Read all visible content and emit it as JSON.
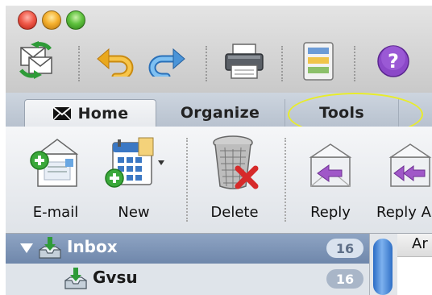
{
  "window": {
    "buttons": [
      "close",
      "minimize",
      "zoom"
    ]
  },
  "toolbar": {
    "icons": [
      "send-receive-icon",
      "undo-icon",
      "redo-icon",
      "print-icon",
      "document-gallery-icon",
      "help-icon"
    ]
  },
  "tabs": [
    {
      "label": "Home",
      "selected": true
    },
    {
      "label": "Organize",
      "selected": false
    },
    {
      "label": "Tools",
      "selected": false,
      "highlighted": true
    }
  ],
  "ribbon": {
    "email": "E-mail",
    "new": "New",
    "delete": "Delete",
    "reply": "Reply",
    "reply_all": "Reply A"
  },
  "folders": [
    {
      "name": "Inbox",
      "count": "16",
      "expanded": true,
      "selected": true
    },
    {
      "name": "Gvsu",
      "count": "16",
      "expanded": false,
      "selected": false
    }
  ],
  "message_list": {
    "header_partial": "Ar"
  },
  "colors": {
    "highlight": "#e8ec2c",
    "selection": "#7b91b4"
  }
}
